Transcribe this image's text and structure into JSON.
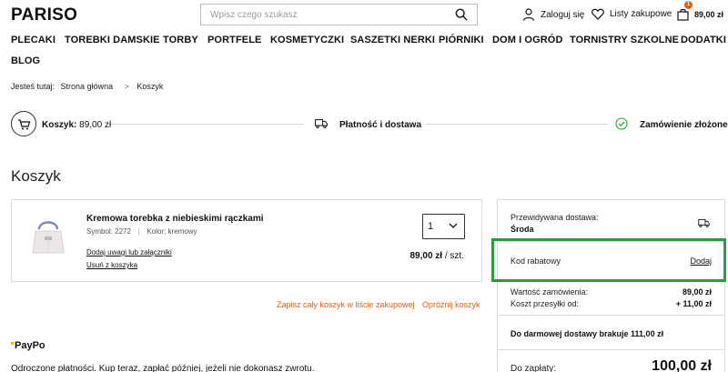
{
  "header": {
    "logo": "PARISO",
    "search_placeholder": "Wpisz czego szukasz",
    "login_label": "Zaloguj się",
    "wishlist_label": "Listy zakupowe",
    "cart_total": "89,00 zł",
    "cart_count": "1"
  },
  "nav": {
    "items": [
      "PLECAKI",
      "TOREBKI DAMSKIE",
      "TORBY",
      "PORTFELE",
      "KOSMETYCZKI",
      "SASZETKI NERKI",
      "PIÓRNIKI",
      "DOM I OGRÓD",
      "TORNISTRY SZKOLNE",
      "DODATKI",
      "BLOG"
    ]
  },
  "breadcrumb": {
    "prefix": "Jesteś tutaj:",
    "home": "Strona główna",
    "separator": ">",
    "current": "Koszyk"
  },
  "steps": {
    "step1": "Koszyk:",
    "step1_value": "89,00 zł",
    "step2": "Płatność i dostawa",
    "step3": "Zamówienie złożone"
  },
  "page": {
    "title": "Koszyk"
  },
  "cart_item": {
    "name": "Kremowa torebka z niebieskimi rączkami",
    "symbol_label": "Symbol:",
    "symbol": "2272",
    "color_label": "Kolor:",
    "color": "kremowy",
    "add_note_link": "Dodaj uwagi lub załączniki",
    "remove_link": "Usuń z koszyka",
    "quantity": "1",
    "price": "89,00 zł",
    "price_unit": "/ szt."
  },
  "cart_actions": {
    "save_to_list": "Zapisz cały koszyk w liście zakupowej",
    "empty_cart": "Opróżnij koszyk"
  },
  "paypo": {
    "logo": "PayPo",
    "text": "Odroczone płatności. Kup teraz, zapłać później, jeżeli nie dokonasz zwrotu."
  },
  "summary": {
    "delivery_label": "Przewidywana dostawa:",
    "delivery_day": "Środa",
    "coupon_label": "Kod rabatowy",
    "coupon_add": "Dodaj",
    "order_value_label": "Wartość zamówienia:",
    "order_value": "89,00 zł",
    "shipping_label": "Koszt przesyłki od:",
    "shipping_value": "+ 11,00 zł",
    "free_shipping": "Do darmowej dostawy brakuje 111,00 zł",
    "to_pay_label": "Do zapłaty:",
    "to_pay": "100,00 zł"
  },
  "colors": {
    "accent": "#e85d12",
    "highlight": "#23a03c",
    "step_check": "#23a03c"
  }
}
